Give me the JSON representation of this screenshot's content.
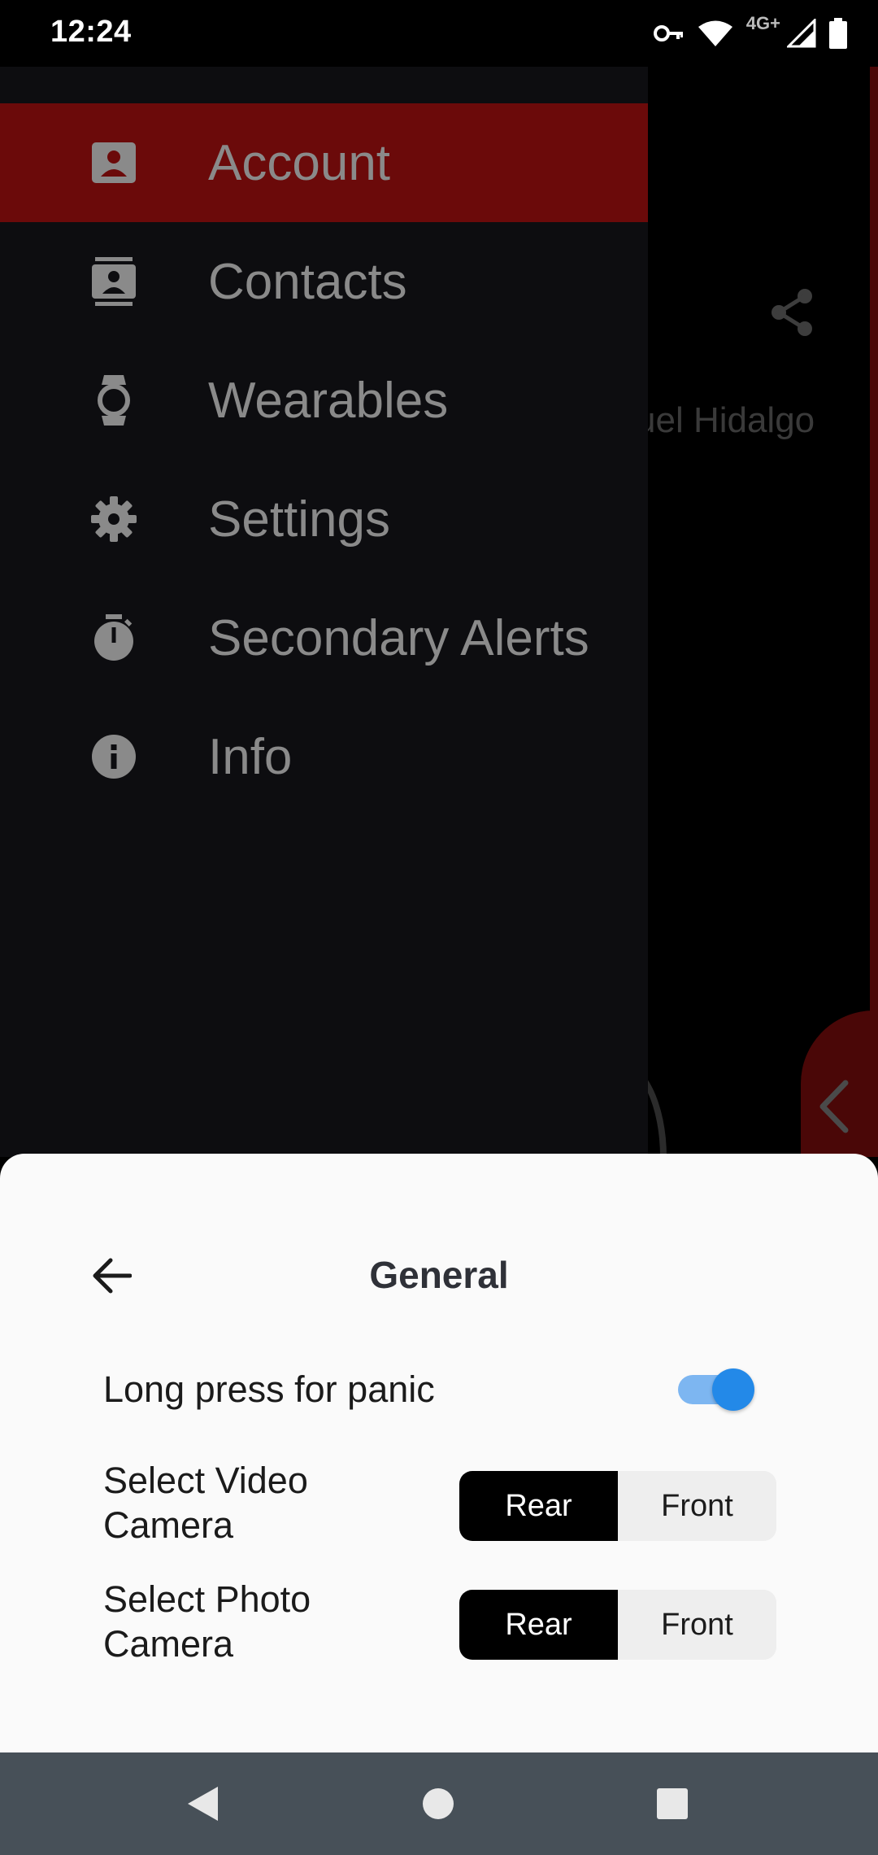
{
  "status_bar": {
    "time": "12:24",
    "network_label": "4G+",
    "icons": [
      "vpn-key-icon",
      "wifi-icon",
      "cell-signal-icon",
      "battery-icon"
    ]
  },
  "background": {
    "partial_name": "uel Hidalgo",
    "icons": [
      "share-icon",
      "chevron-left-icon"
    ]
  },
  "drawer": {
    "items": [
      {
        "label": "Account",
        "icon": "account-box-icon",
        "active": true
      },
      {
        "label": "Contacts",
        "icon": "contacts-icon",
        "active": false
      },
      {
        "label": "Wearables",
        "icon": "watch-icon",
        "active": false
      },
      {
        "label": "Settings",
        "icon": "gear-icon",
        "active": false
      },
      {
        "label": "Secondary Alerts",
        "icon": "timer-icon",
        "active": false
      },
      {
        "label": "Info",
        "icon": "info-icon",
        "active": false
      }
    ]
  },
  "sheet": {
    "title": "General",
    "long_press": {
      "label": "Long press for panic",
      "enabled": true
    },
    "video_camera": {
      "label": "Select Video Camera",
      "options": [
        "Rear",
        "Front"
      ],
      "selected": "Rear"
    },
    "photo_camera": {
      "label": "Select Photo Camera",
      "options": [
        "Rear",
        "Front"
      ],
      "selected": "Rear"
    }
  },
  "colors": {
    "drawer_active": "#6b0a0a",
    "toggle_on": "#2389e8",
    "segment_selected": "#000000"
  },
  "nav_bar": {
    "buttons": [
      "back-triangle-icon",
      "home-circle-icon",
      "recents-square-icon"
    ]
  }
}
